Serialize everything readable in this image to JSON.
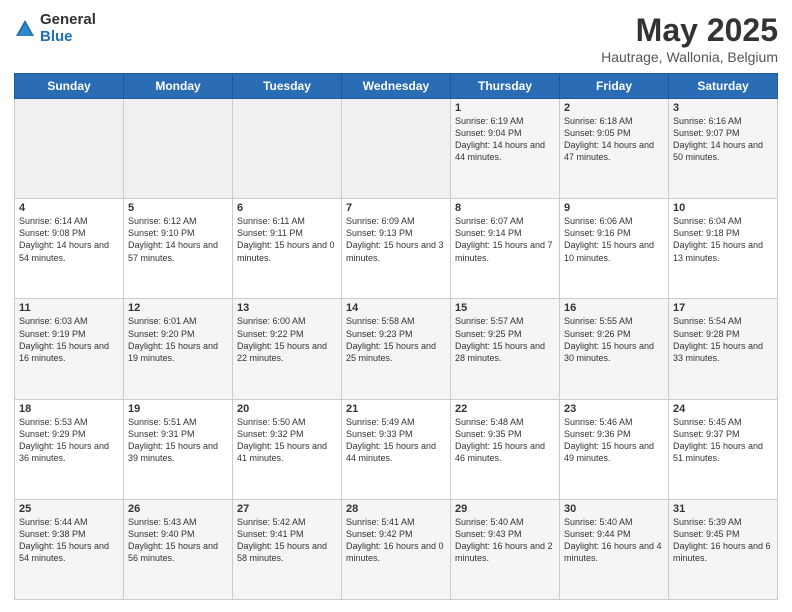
{
  "logo": {
    "general": "General",
    "blue": "Blue"
  },
  "header": {
    "month": "May 2025",
    "location": "Hautrage, Wallonia, Belgium"
  },
  "days": [
    "Sunday",
    "Monday",
    "Tuesday",
    "Wednesday",
    "Thursday",
    "Friday",
    "Saturday"
  ],
  "weeks": [
    [
      {
        "day": "",
        "info": ""
      },
      {
        "day": "",
        "info": ""
      },
      {
        "day": "",
        "info": ""
      },
      {
        "day": "",
        "info": ""
      },
      {
        "day": "1",
        "info": "Sunrise: 6:19 AM\nSunset: 9:04 PM\nDaylight: 14 hours and 44 minutes."
      },
      {
        "day": "2",
        "info": "Sunrise: 6:18 AM\nSunset: 9:05 PM\nDaylight: 14 hours and 47 minutes."
      },
      {
        "day": "3",
        "info": "Sunrise: 6:16 AM\nSunset: 9:07 PM\nDaylight: 14 hours and 50 minutes."
      }
    ],
    [
      {
        "day": "4",
        "info": "Sunrise: 6:14 AM\nSunset: 9:08 PM\nDaylight: 14 hours and 54 minutes."
      },
      {
        "day": "5",
        "info": "Sunrise: 6:12 AM\nSunset: 9:10 PM\nDaylight: 14 hours and 57 minutes."
      },
      {
        "day": "6",
        "info": "Sunrise: 6:11 AM\nSunset: 9:11 PM\nDaylight: 15 hours and 0 minutes."
      },
      {
        "day": "7",
        "info": "Sunrise: 6:09 AM\nSunset: 9:13 PM\nDaylight: 15 hours and 3 minutes."
      },
      {
        "day": "8",
        "info": "Sunrise: 6:07 AM\nSunset: 9:14 PM\nDaylight: 15 hours and 7 minutes."
      },
      {
        "day": "9",
        "info": "Sunrise: 6:06 AM\nSunset: 9:16 PM\nDaylight: 15 hours and 10 minutes."
      },
      {
        "day": "10",
        "info": "Sunrise: 6:04 AM\nSunset: 9:18 PM\nDaylight: 15 hours and 13 minutes."
      }
    ],
    [
      {
        "day": "11",
        "info": "Sunrise: 6:03 AM\nSunset: 9:19 PM\nDaylight: 15 hours and 16 minutes."
      },
      {
        "day": "12",
        "info": "Sunrise: 6:01 AM\nSunset: 9:20 PM\nDaylight: 15 hours and 19 minutes."
      },
      {
        "day": "13",
        "info": "Sunrise: 6:00 AM\nSunset: 9:22 PM\nDaylight: 15 hours and 22 minutes."
      },
      {
        "day": "14",
        "info": "Sunrise: 5:58 AM\nSunset: 9:23 PM\nDaylight: 15 hours and 25 minutes."
      },
      {
        "day": "15",
        "info": "Sunrise: 5:57 AM\nSunset: 9:25 PM\nDaylight: 15 hours and 28 minutes."
      },
      {
        "day": "16",
        "info": "Sunrise: 5:55 AM\nSunset: 9:26 PM\nDaylight: 15 hours and 30 minutes."
      },
      {
        "day": "17",
        "info": "Sunrise: 5:54 AM\nSunset: 9:28 PM\nDaylight: 15 hours and 33 minutes."
      }
    ],
    [
      {
        "day": "18",
        "info": "Sunrise: 5:53 AM\nSunset: 9:29 PM\nDaylight: 15 hours and 36 minutes."
      },
      {
        "day": "19",
        "info": "Sunrise: 5:51 AM\nSunset: 9:31 PM\nDaylight: 15 hours and 39 minutes."
      },
      {
        "day": "20",
        "info": "Sunrise: 5:50 AM\nSunset: 9:32 PM\nDaylight: 15 hours and 41 minutes."
      },
      {
        "day": "21",
        "info": "Sunrise: 5:49 AM\nSunset: 9:33 PM\nDaylight: 15 hours and 44 minutes."
      },
      {
        "day": "22",
        "info": "Sunrise: 5:48 AM\nSunset: 9:35 PM\nDaylight: 15 hours and 46 minutes."
      },
      {
        "day": "23",
        "info": "Sunrise: 5:46 AM\nSunset: 9:36 PM\nDaylight: 15 hours and 49 minutes."
      },
      {
        "day": "24",
        "info": "Sunrise: 5:45 AM\nSunset: 9:37 PM\nDaylight: 15 hours and 51 minutes."
      }
    ],
    [
      {
        "day": "25",
        "info": "Sunrise: 5:44 AM\nSunset: 9:38 PM\nDaylight: 15 hours and 54 minutes."
      },
      {
        "day": "26",
        "info": "Sunrise: 5:43 AM\nSunset: 9:40 PM\nDaylight: 15 hours and 56 minutes."
      },
      {
        "day": "27",
        "info": "Sunrise: 5:42 AM\nSunset: 9:41 PM\nDaylight: 15 hours and 58 minutes."
      },
      {
        "day": "28",
        "info": "Sunrise: 5:41 AM\nSunset: 9:42 PM\nDaylight: 16 hours and 0 minutes."
      },
      {
        "day": "29",
        "info": "Sunrise: 5:40 AM\nSunset: 9:43 PM\nDaylight: 16 hours and 2 minutes."
      },
      {
        "day": "30",
        "info": "Sunrise: 5:40 AM\nSunset: 9:44 PM\nDaylight: 16 hours and 4 minutes."
      },
      {
        "day": "31",
        "info": "Sunrise: 5:39 AM\nSunset: 9:45 PM\nDaylight: 16 hours and 6 minutes."
      }
    ]
  ]
}
